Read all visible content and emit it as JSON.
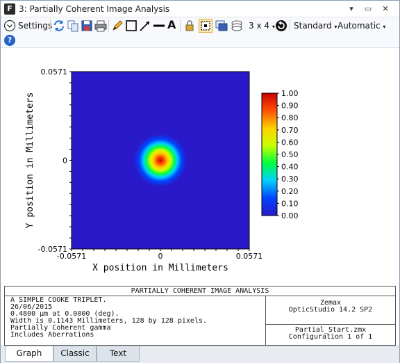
{
  "window": {
    "app_icon_letter": "F",
    "title": "3: Partially Coherent Image Analysis",
    "controls": [
      "▾",
      "▭",
      "✕"
    ]
  },
  "toolbar": {
    "settings_label": "Settings",
    "layout_label": "3 x 4",
    "standard_label": "Standard",
    "automatic_label": "Automatic",
    "text_tool_glyph": "A",
    "help_glyph": "?"
  },
  "chart_data": {
    "type": "heatmap",
    "title": "",
    "xlabel": "X position in Millimeters",
    "ylabel": "Y position in Millimeters",
    "x_ticks": [
      "-0.0571",
      "0",
      "0.0571"
    ],
    "y_ticks": [
      "0.0571",
      "0",
      "-0.0571"
    ],
    "xlim": [
      -0.0571,
      0.0571
    ],
    "ylim": [
      -0.0571,
      0.0571
    ],
    "colorbar": {
      "min": 0.0,
      "max": 1.0,
      "ticks": [
        "1.00",
        "0.90",
        "0.80",
        "0.70",
        "0.60",
        "0.50",
        "0.40",
        "0.30",
        "0.20",
        "0.10",
        "0.00"
      ]
    },
    "spot": {
      "center_x": 0.0,
      "center_y": 0.0,
      "peak": 1.0,
      "background": 0.0
    },
    "colormap": [
      "#2a19c8",
      "#0044ff",
      "#00d0ff",
      "#00ff40",
      "#c8ff00",
      "#ffd000",
      "#ff5000",
      "#cc0000"
    ]
  },
  "info_panel": {
    "title": "PARTIALLY COHERENT IMAGE ANALYSIS",
    "lines": [
      "A SIMPLE COOKE TRIPLET.",
      "26/06/2015",
      "0.4800 µm at 0.0000 (deg).",
      "Width is 0.1143 Millimeters, 128 by 128 pixels.",
      "Partially Coherent gamma",
      "Includes Aberrations"
    ],
    "vendor": "Zemax",
    "product": "OpticStudio 14.2 SP2",
    "file": "Partial_Start.zmx",
    "configuration": "Configuration 1 of 1"
  },
  "tabs": [
    "Graph",
    "Classic",
    "Text"
  ],
  "active_tab": "Graph"
}
